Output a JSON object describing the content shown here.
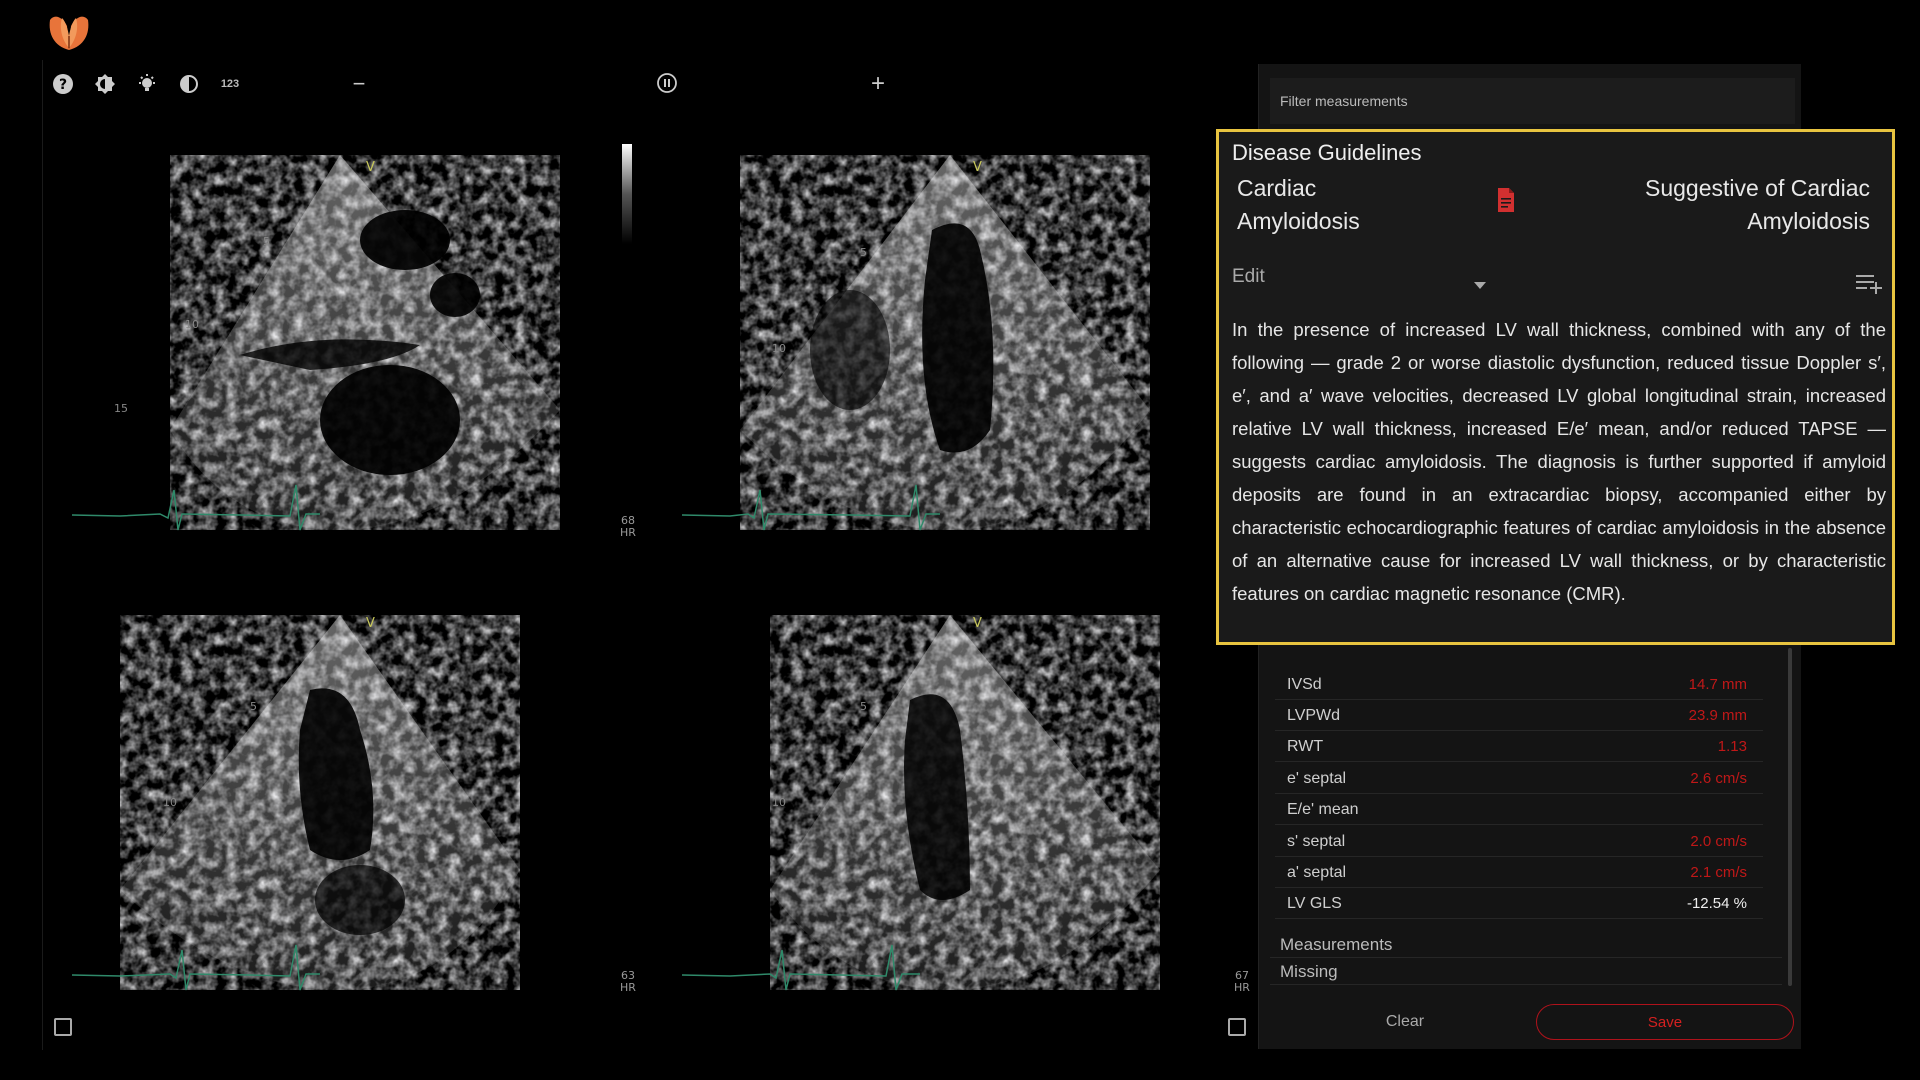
{
  "toolbar": {
    "help_icon": "question-circle",
    "contrast_icon": "brightness",
    "light_icon": "bulb",
    "invert_icon": "half-circle",
    "numbers_label": "123",
    "zoom_out_label": "−",
    "pause_icon": "pause-circle",
    "zoom_in_label": "+"
  },
  "viewports": [
    {
      "depth_labels": [
        "5",
        "10",
        "15"
      ],
      "marker": "V",
      "hr": null
    },
    {
      "depth_labels": [
        "5",
        "10"
      ],
      "marker": "V",
      "hr": {
        "value": "68",
        "unit": "HR"
      }
    },
    {
      "depth_labels": [
        "5",
        "10"
      ],
      "marker": "V",
      "hr": {
        "value": "63",
        "unit": "HR"
      }
    },
    {
      "depth_labels": [
        "5",
        "10"
      ],
      "marker": "V",
      "hr": {
        "value": "67",
        "unit": "HR"
      }
    }
  ],
  "panel": {
    "filter_placeholder": "Filter measurements",
    "guidelines": {
      "title": "Disease Guidelines",
      "disease": "Cardiac Amyloidosis",
      "result": "Suggestive of Cardiac Amyloidosis",
      "edit_label": "Edit",
      "text": "In the presence of increased LV wall thickness, combined with any of the following — grade 2 or worse diastolic dysfunction, reduced tissue Doppler s′, e′, and a′ wave velocities, decreased LV global longitudinal strain, increased relative LV wall thickness, increased E/e′ mean, and/or reduced TAPSE — suggests cardiac amyloidosis. The diagnosis is further supported if amyloid deposits are found in an extracardiac biopsy, accompanied either by characteristic echocardiographic features of cardiac amyloidosis in the absence of an alternative cause for increased LV wall thickness, or by characteristic features on cardiac magnetic resonance (CMR)."
    },
    "measurements": [
      {
        "label": "IVSd",
        "value": "14.7 mm",
        "abnormal": true
      },
      {
        "label": "LVPWd",
        "value": "23.9 mm",
        "abnormal": true
      },
      {
        "label": "RWT",
        "value": "1.13",
        "abnormal": true
      },
      {
        "label": "e' septal",
        "value": "2.6 cm/s",
        "abnormal": true
      },
      {
        "label": "E/e' mean",
        "value": "",
        "abnormal": false
      },
      {
        "label": "s' septal",
        "value": "2.0 cm/s",
        "abnormal": true
      },
      {
        "label": "a' septal",
        "value": "2.1 cm/s",
        "abnormal": true
      },
      {
        "label": "LV GLS",
        "value": "-12.54 %",
        "abnormal": false
      }
    ],
    "sections": {
      "measurements_label": "Measurements",
      "missing_label": "Missing"
    },
    "clear_label": "Clear",
    "save_label": "Save"
  },
  "colors": {
    "accent_highlight": "#e8c440",
    "abnormal_value": "#c01818",
    "save_border": "#b0121b",
    "ecg_trace": "#2f8a6a",
    "logo_orange": "#e8743a"
  }
}
